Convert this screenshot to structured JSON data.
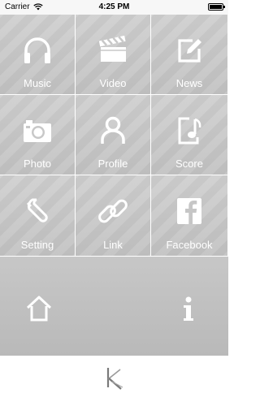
{
  "status_bar": {
    "carrier": "Carrier",
    "time": "4:25 PM"
  },
  "tiles": [
    {
      "label": "Music",
      "icon": "headphones-icon"
    },
    {
      "label": "Video",
      "icon": "clapperboard-icon"
    },
    {
      "label": "News",
      "icon": "edit-icon"
    },
    {
      "label": "Photo",
      "icon": "camera-icon"
    },
    {
      "label": "Profile",
      "icon": "user-icon"
    },
    {
      "label": "Score",
      "icon": "music-note-icon"
    },
    {
      "label": "Setting",
      "icon": "wrench-icon"
    },
    {
      "label": "Link",
      "icon": "link-icon"
    },
    {
      "label": "Facebook",
      "icon": "facebook-icon"
    }
  ],
  "bottom_bar": {
    "home_icon": "home-icon",
    "info_icon": "info-icon"
  },
  "colors": {
    "tile": "#c9c9c9",
    "bottom_bar": "#c0c0c0",
    "icon": "#ffffff"
  }
}
